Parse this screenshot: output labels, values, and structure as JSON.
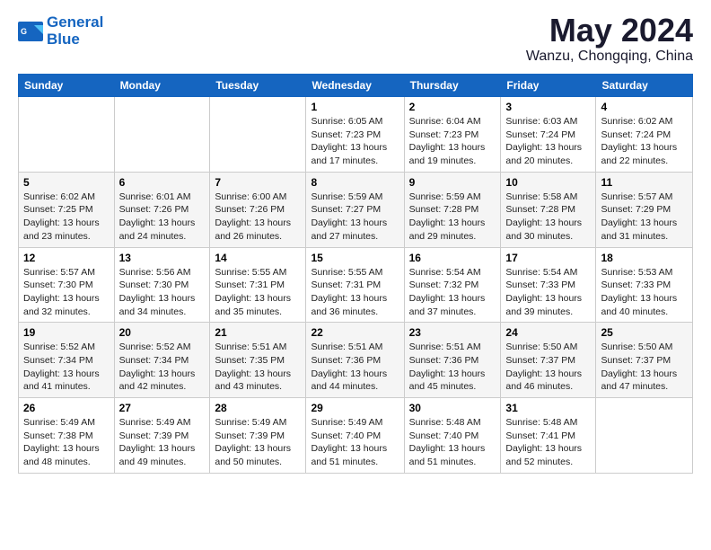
{
  "logo": {
    "line1": "General",
    "line2": "Blue"
  },
  "title": {
    "month_year": "May 2024",
    "location": "Wanzu, Chongqing, China"
  },
  "weekdays": [
    "Sunday",
    "Monday",
    "Tuesday",
    "Wednesday",
    "Thursday",
    "Friday",
    "Saturday"
  ],
  "weeks": [
    [
      {
        "day": "",
        "sunrise": "",
        "sunset": "",
        "daylight": ""
      },
      {
        "day": "",
        "sunrise": "",
        "sunset": "",
        "daylight": ""
      },
      {
        "day": "",
        "sunrise": "",
        "sunset": "",
        "daylight": ""
      },
      {
        "day": "1",
        "sunrise": "Sunrise: 6:05 AM",
        "sunset": "Sunset: 7:23 PM",
        "daylight": "Daylight: 13 hours and 17 minutes."
      },
      {
        "day": "2",
        "sunrise": "Sunrise: 6:04 AM",
        "sunset": "Sunset: 7:23 PM",
        "daylight": "Daylight: 13 hours and 19 minutes."
      },
      {
        "day": "3",
        "sunrise": "Sunrise: 6:03 AM",
        "sunset": "Sunset: 7:24 PM",
        "daylight": "Daylight: 13 hours and 20 minutes."
      },
      {
        "day": "4",
        "sunrise": "Sunrise: 6:02 AM",
        "sunset": "Sunset: 7:24 PM",
        "daylight": "Daylight: 13 hours and 22 minutes."
      }
    ],
    [
      {
        "day": "5",
        "sunrise": "Sunrise: 6:02 AM",
        "sunset": "Sunset: 7:25 PM",
        "daylight": "Daylight: 13 hours and 23 minutes."
      },
      {
        "day": "6",
        "sunrise": "Sunrise: 6:01 AM",
        "sunset": "Sunset: 7:26 PM",
        "daylight": "Daylight: 13 hours and 24 minutes."
      },
      {
        "day": "7",
        "sunrise": "Sunrise: 6:00 AM",
        "sunset": "Sunset: 7:26 PM",
        "daylight": "Daylight: 13 hours and 26 minutes."
      },
      {
        "day": "8",
        "sunrise": "Sunrise: 5:59 AM",
        "sunset": "Sunset: 7:27 PM",
        "daylight": "Daylight: 13 hours and 27 minutes."
      },
      {
        "day": "9",
        "sunrise": "Sunrise: 5:59 AM",
        "sunset": "Sunset: 7:28 PM",
        "daylight": "Daylight: 13 hours and 29 minutes."
      },
      {
        "day": "10",
        "sunrise": "Sunrise: 5:58 AM",
        "sunset": "Sunset: 7:28 PM",
        "daylight": "Daylight: 13 hours and 30 minutes."
      },
      {
        "day": "11",
        "sunrise": "Sunrise: 5:57 AM",
        "sunset": "Sunset: 7:29 PM",
        "daylight": "Daylight: 13 hours and 31 minutes."
      }
    ],
    [
      {
        "day": "12",
        "sunrise": "Sunrise: 5:57 AM",
        "sunset": "Sunset: 7:30 PM",
        "daylight": "Daylight: 13 hours and 32 minutes."
      },
      {
        "day": "13",
        "sunrise": "Sunrise: 5:56 AM",
        "sunset": "Sunset: 7:30 PM",
        "daylight": "Daylight: 13 hours and 34 minutes."
      },
      {
        "day": "14",
        "sunrise": "Sunrise: 5:55 AM",
        "sunset": "Sunset: 7:31 PM",
        "daylight": "Daylight: 13 hours and 35 minutes."
      },
      {
        "day": "15",
        "sunrise": "Sunrise: 5:55 AM",
        "sunset": "Sunset: 7:31 PM",
        "daylight": "Daylight: 13 hours and 36 minutes."
      },
      {
        "day": "16",
        "sunrise": "Sunrise: 5:54 AM",
        "sunset": "Sunset: 7:32 PM",
        "daylight": "Daylight: 13 hours and 37 minutes."
      },
      {
        "day": "17",
        "sunrise": "Sunrise: 5:54 AM",
        "sunset": "Sunset: 7:33 PM",
        "daylight": "Daylight: 13 hours and 39 minutes."
      },
      {
        "day": "18",
        "sunrise": "Sunrise: 5:53 AM",
        "sunset": "Sunset: 7:33 PM",
        "daylight": "Daylight: 13 hours and 40 minutes."
      }
    ],
    [
      {
        "day": "19",
        "sunrise": "Sunrise: 5:52 AM",
        "sunset": "Sunset: 7:34 PM",
        "daylight": "Daylight: 13 hours and 41 minutes."
      },
      {
        "day": "20",
        "sunrise": "Sunrise: 5:52 AM",
        "sunset": "Sunset: 7:34 PM",
        "daylight": "Daylight: 13 hours and 42 minutes."
      },
      {
        "day": "21",
        "sunrise": "Sunrise: 5:51 AM",
        "sunset": "Sunset: 7:35 PM",
        "daylight": "Daylight: 13 hours and 43 minutes."
      },
      {
        "day": "22",
        "sunrise": "Sunrise: 5:51 AM",
        "sunset": "Sunset: 7:36 PM",
        "daylight": "Daylight: 13 hours and 44 minutes."
      },
      {
        "day": "23",
        "sunrise": "Sunrise: 5:51 AM",
        "sunset": "Sunset: 7:36 PM",
        "daylight": "Daylight: 13 hours and 45 minutes."
      },
      {
        "day": "24",
        "sunrise": "Sunrise: 5:50 AM",
        "sunset": "Sunset: 7:37 PM",
        "daylight": "Daylight: 13 hours and 46 minutes."
      },
      {
        "day": "25",
        "sunrise": "Sunrise: 5:50 AM",
        "sunset": "Sunset: 7:37 PM",
        "daylight": "Daylight: 13 hours and 47 minutes."
      }
    ],
    [
      {
        "day": "26",
        "sunrise": "Sunrise: 5:49 AM",
        "sunset": "Sunset: 7:38 PM",
        "daylight": "Daylight: 13 hours and 48 minutes."
      },
      {
        "day": "27",
        "sunrise": "Sunrise: 5:49 AM",
        "sunset": "Sunset: 7:39 PM",
        "daylight": "Daylight: 13 hours and 49 minutes."
      },
      {
        "day": "28",
        "sunrise": "Sunrise: 5:49 AM",
        "sunset": "Sunset: 7:39 PM",
        "daylight": "Daylight: 13 hours and 50 minutes."
      },
      {
        "day": "29",
        "sunrise": "Sunrise: 5:49 AM",
        "sunset": "Sunset: 7:40 PM",
        "daylight": "Daylight: 13 hours and 51 minutes."
      },
      {
        "day": "30",
        "sunrise": "Sunrise: 5:48 AM",
        "sunset": "Sunset: 7:40 PM",
        "daylight": "Daylight: 13 hours and 51 minutes."
      },
      {
        "day": "31",
        "sunrise": "Sunrise: 5:48 AM",
        "sunset": "Sunset: 7:41 PM",
        "daylight": "Daylight: 13 hours and 52 minutes."
      },
      {
        "day": "",
        "sunrise": "",
        "sunset": "",
        "daylight": ""
      }
    ]
  ]
}
